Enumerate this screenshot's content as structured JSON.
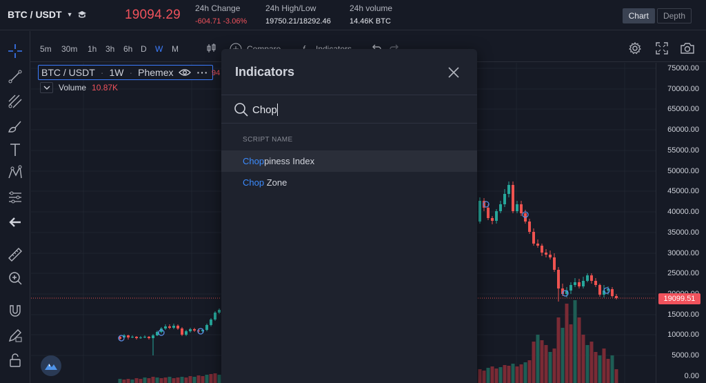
{
  "header": {
    "pair": "BTC / USDT",
    "last_price": "19094.29",
    "stats": [
      {
        "label": "24h Change",
        "value": "-604.71 -3.06%",
        "negative": true
      },
      {
        "label": "24h High/Low",
        "value": "19750.21/18292.46",
        "negative": false
      },
      {
        "label": "24h volume",
        "value": "14.46K BTC",
        "negative": false
      }
    ],
    "view_toggle": {
      "chart": "Chart",
      "depth": "Depth",
      "selected": "Chart"
    }
  },
  "toolbar": {
    "timeframes": [
      "5m",
      "30m",
      "1h",
      "3h",
      "6h",
      "D",
      "W",
      "M"
    ],
    "active_timeframe": "W",
    "compare_label": "Compare",
    "indicators_label": "Indicators"
  },
  "legend": {
    "symbol": "BTC / USDT",
    "interval": "1W",
    "exchange": "Phemex",
    "partial_value": "94",
    "volume_label": "Volume",
    "volume_value": "10.87K"
  },
  "price_axis": {
    "ticks": [
      "75000.00",
      "70000.00",
      "65000.00",
      "60000.00",
      "55000.00",
      "50000.00",
      "45000.00",
      "40000.00",
      "35000.00",
      "30000.00",
      "25000.00",
      "20000.00",
      "15000.00",
      "10000.00",
      "5000.00",
      "0.00"
    ],
    "current_price": "19099.51"
  },
  "colors": {
    "up": "#26a69a",
    "down": "#ef5350",
    "accent": "#3c7dff",
    "background": "#161a25"
  },
  "modal": {
    "title": "Indicators",
    "search_value": "Chop",
    "search_placeholder": "Search",
    "section_header": "SCRIPT NAME",
    "results": [
      {
        "match": "Chop",
        "rest": "piness Index",
        "highlighted": true
      },
      {
        "match": "Chop",
        "rest": " Zone",
        "highlighted": false
      }
    ]
  },
  "icons": {
    "left_toolbar": [
      "crosshair-icon",
      "trend-line-icon",
      "pitchfork-icon",
      "brush-icon",
      "text-icon",
      "pattern-icon",
      "prediction-icon",
      "back-arrow-icon",
      "ruler-icon",
      "zoom-in-icon",
      "magnet-icon",
      "lock-pencil-icon",
      "lock-icon"
    ],
    "top_right": [
      "settings-icon",
      "fullscreen-icon",
      "camera-icon"
    ]
  }
}
